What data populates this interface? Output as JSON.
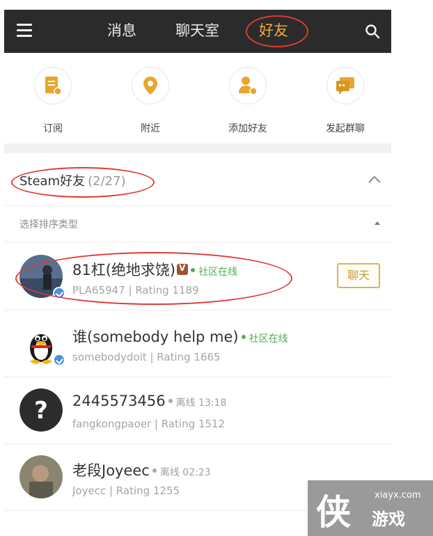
{
  "topbar": {
    "tabs": [
      {
        "label": "消息"
      },
      {
        "label": "聊天室"
      },
      {
        "label": "好友"
      }
    ],
    "active_tab_color": "#f0a838"
  },
  "quick_actions": [
    {
      "label": "订阅",
      "icon": "subscribe-icon"
    },
    {
      "label": "附近",
      "icon": "location-pin-icon"
    },
    {
      "label": "添加好友",
      "icon": "add-friend-icon"
    },
    {
      "label": "发起群聊",
      "icon": "group-chat-icon"
    }
  ],
  "group": {
    "title": "Steam好友",
    "count": "(2/27)"
  },
  "sort": {
    "label": "选择排序类型"
  },
  "friends": [
    {
      "name": "81杠(绝地求饶)",
      "status": "社区在线",
      "status_type": "online",
      "sub": "PLA65947 | Rating 1189",
      "chat_label": "聊天"
    },
    {
      "name": "谁(somebody help me)",
      "status": "社区在线",
      "status_type": "online",
      "sub": "somebodydoit | Rating 1665"
    },
    {
      "name": "2445573456",
      "status": "离线 13:18",
      "status_type": "offline",
      "sub": "fangkongpaoer | Rating 1512"
    },
    {
      "name": "老段Joyeec",
      "status": "离线 02:23",
      "status_type": "offline",
      "sub": "Joyecc | Rating 1255"
    }
  ],
  "watermark": {
    "glyph": "侠",
    "url": "xiayx.com",
    "text": "游戏"
  },
  "colors": {
    "accent": "#f0a838",
    "online": "#4caf50",
    "annotation_red": "#e23a34"
  }
}
